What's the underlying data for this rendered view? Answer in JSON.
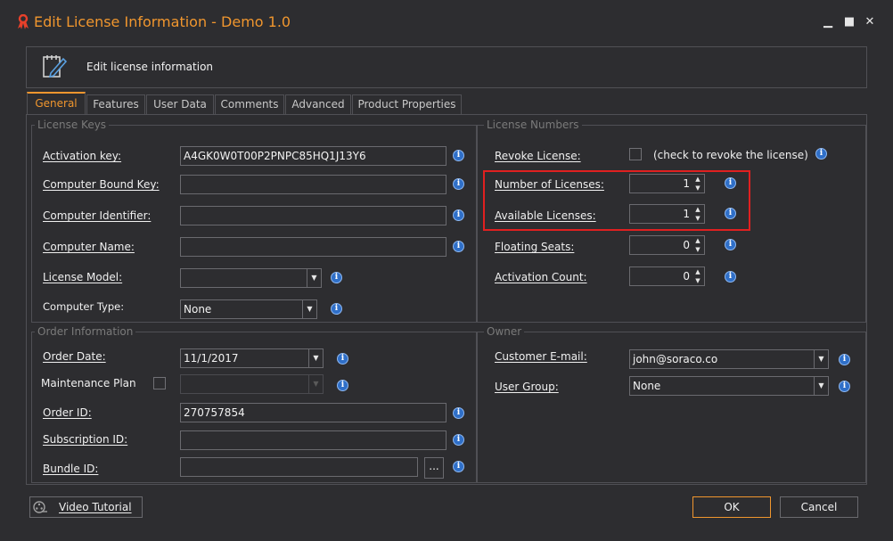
{
  "window": {
    "title": "Edit License Information - Demo 1.0",
    "controls": {
      "minimize": "▁",
      "maximize": "■",
      "close": "✕"
    }
  },
  "header": {
    "text": "Edit license information"
  },
  "tabs": [
    {
      "label": "General",
      "active": true
    },
    {
      "label": "Features"
    },
    {
      "label": "User Data"
    },
    {
      "label": "Comments"
    },
    {
      "label": "Advanced"
    },
    {
      "label": "Product Properties"
    }
  ],
  "license_keys": {
    "title": "License Keys",
    "activation_key": {
      "label": "Activation key:",
      "value": "A4GK0W0T00P2PNPC85HQ1J13Y6"
    },
    "computer_bound_key": {
      "label": "Computer Bound Key:",
      "value": ""
    },
    "computer_identifier": {
      "label": "Computer Identifier:",
      "value": ""
    },
    "computer_name": {
      "label": "Computer Name:",
      "value": ""
    },
    "license_model": {
      "label": "License Model:",
      "value": ""
    },
    "computer_type": {
      "label": "Computer Type:",
      "value": "None"
    }
  },
  "license_numbers": {
    "title": "License Numbers",
    "revoke": {
      "label": "Revoke License:",
      "hint": "(check to revoke the license)",
      "checked": false
    },
    "number_of_licenses": {
      "label": "Number of Licenses:",
      "value": "1"
    },
    "available_licenses": {
      "label": "Available Licenses:",
      "value": "1"
    },
    "floating_seats": {
      "label": "Floating Seats:",
      "value": "0"
    },
    "activation_count": {
      "label": "Activation Count:",
      "value": "0"
    }
  },
  "order_information": {
    "title": "Order Information",
    "order_date": {
      "label": "Order Date:",
      "value": "11/1/2017"
    },
    "maintenance_plan": {
      "label": "Maintenance Plan",
      "value": "",
      "checked": false
    },
    "order_id": {
      "label": "Order ID:",
      "value": "270757854"
    },
    "subscription_id": {
      "label": "Subscription ID:",
      "value": ""
    },
    "bundle_id": {
      "label": "Bundle ID:",
      "value": "",
      "browse_label": "..."
    }
  },
  "owner": {
    "title": "Owner",
    "customer_email": {
      "label": "Customer E-mail:",
      "value": "john@soraco.co"
    },
    "user_group": {
      "label": "User Group:",
      "value": "None"
    }
  },
  "footer": {
    "video_tutorial_label": "Video Tutorial",
    "ok_label": "OK",
    "cancel_label": "Cancel"
  },
  "glyphs": {
    "info": "i",
    "dropdown": "▼",
    "spin_up": "▲",
    "spin_down": "▼"
  },
  "colors": {
    "accent": "#f0962e",
    "background": "#2d2d30",
    "highlight": "#e02020",
    "info_blue": "#2f6fc8"
  },
  "icons": {
    "app": "ribbon-icon",
    "header": "edit-document-icon",
    "video": "film-reel-icon",
    "info": "info-icon"
  }
}
